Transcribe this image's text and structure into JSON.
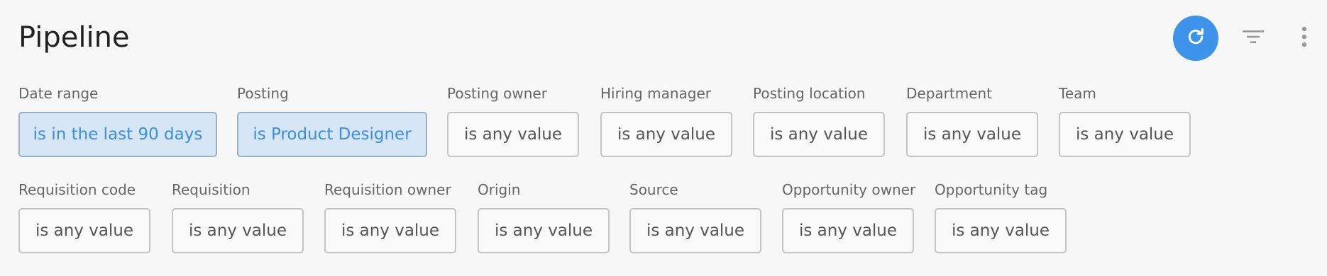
{
  "header": {
    "title": "Pipeline"
  },
  "actions": {
    "refresh_icon": "refresh-icon",
    "filter_icon": "filter-icon",
    "more_icon": "more-vertical-icon",
    "accent_color": "#3d93e9"
  },
  "filters": {
    "row1": [
      {
        "label": "Date range",
        "value": "is in the last 90 days",
        "active": true
      },
      {
        "label": "Posting",
        "value": "is Product Designer",
        "active": true
      },
      {
        "label": "Posting owner",
        "value": "is any value",
        "active": false
      },
      {
        "label": "Hiring manager",
        "value": "is any value",
        "active": false
      },
      {
        "label": "Posting location",
        "value": "is any value",
        "active": false
      },
      {
        "label": "Department",
        "value": "is any value",
        "active": false
      },
      {
        "label": "Team",
        "value": "is any value",
        "active": false
      }
    ],
    "row2": [
      {
        "label": "Requisition code",
        "value": "is any value",
        "active": false
      },
      {
        "label": "Requisition",
        "value": "is any value",
        "active": false
      },
      {
        "label": "Requisition owner",
        "value": "is any value",
        "active": false
      },
      {
        "label": "Origin",
        "value": "is any value",
        "active": false
      },
      {
        "label": "Source",
        "value": "is any value",
        "active": false
      },
      {
        "label": "Opportunity owner",
        "value": "is any value",
        "active": false
      },
      {
        "label": "Opportunity tag",
        "value": "is any value",
        "active": false
      }
    ]
  }
}
